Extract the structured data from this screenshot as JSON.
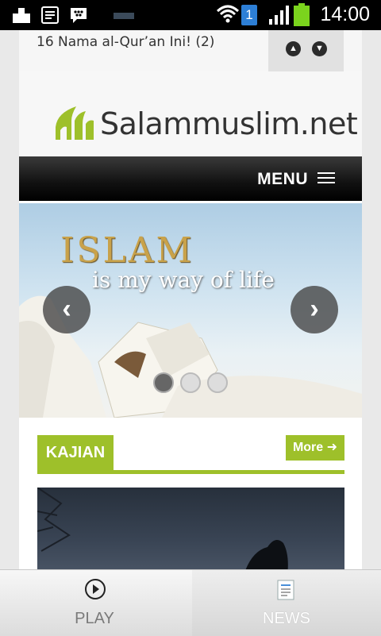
{
  "status_bar": {
    "time": "14:00",
    "sim_badge": "1",
    "battery_color": "#7bd41d",
    "icons": [
      "upload-icon",
      "notes-icon",
      "blackberry-icon",
      "usb-icon",
      "wifi-icon",
      "sim-icon",
      "signal-icon",
      "battery-icon"
    ]
  },
  "ticker": {
    "text": "16 Nama al-Qur’an Ini! (2)",
    "prev_icon": "arrow-up-icon",
    "next_icon": "arrow-down-icon"
  },
  "site": {
    "logo_text": "Salammuslim.net",
    "logo_color": "#9ec02a",
    "menu_label": "MENU"
  },
  "slider": {
    "title": "ISLAM",
    "subtitle": "is my way of life",
    "prev_icon": "chevron-left-icon",
    "next_icon": "chevron-right-icon",
    "slide_count": 3,
    "active_slide": 1
  },
  "section": {
    "title": "KAJIAN",
    "more_label": "More",
    "accent_color": "#9ec02a"
  },
  "tabs": [
    {
      "label": "PLAY",
      "icon": "play-circle-icon",
      "selected": false
    },
    {
      "label": "NEWS",
      "icon": "newspaper-icon",
      "selected": true
    }
  ]
}
